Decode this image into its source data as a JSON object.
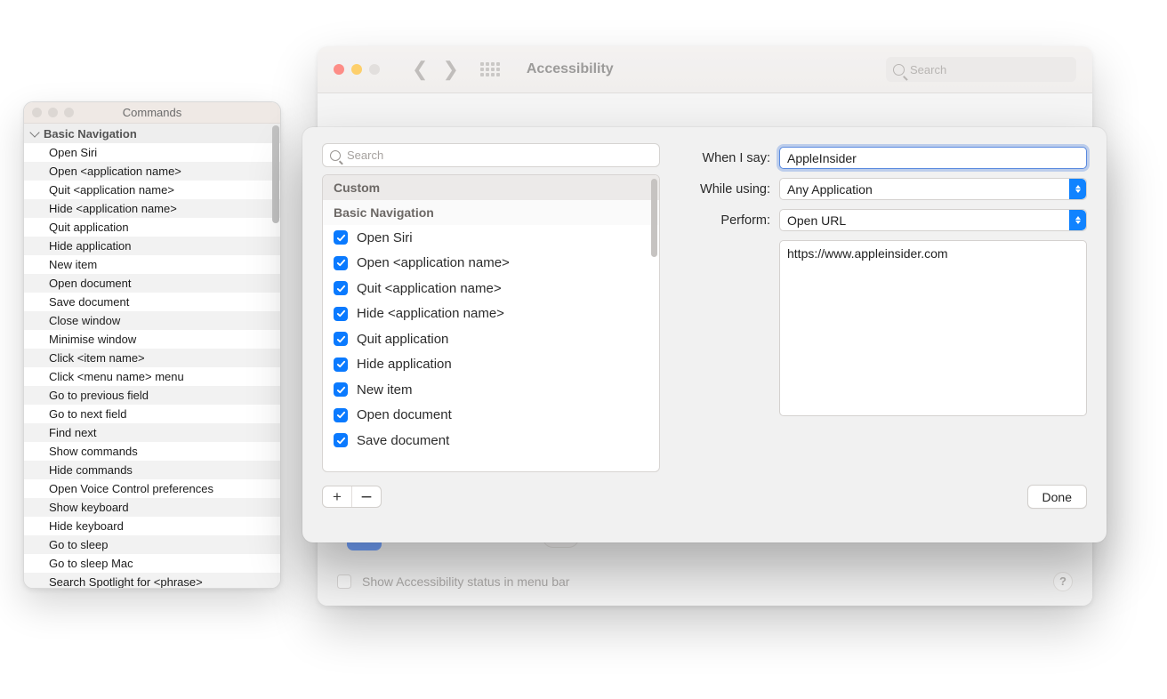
{
  "commandsWindow": {
    "title": "Commands",
    "groupHeader": "Basic Navigation",
    "items": [
      "Open Siri",
      "Open <application name>",
      "Quit <application name>",
      "Hide <application name>",
      "Quit application",
      "Hide application",
      "New item",
      "Open document",
      "Save document",
      "Close window",
      "Minimise window",
      "Click <item name>",
      "Click <menu name> menu",
      "Go to previous field",
      "Go to next field",
      "Find next",
      "Show commands",
      "Hide commands",
      "Open Voice Control preferences",
      "Show keyboard",
      "Hide keyboard",
      "Go to sleep",
      "Go to sleep Mac",
      "Search Spotlight for <phrase>"
    ]
  },
  "prefs": {
    "title": "Accessibility",
    "searchPlaceholder": "Search",
    "footerCheckboxLabel": "Show Accessibility status in menu bar"
  },
  "sheet": {
    "searchPlaceholder": "Search",
    "sections": {
      "custom": "Custom",
      "basic": "Basic Navigation"
    },
    "checkedCommands": [
      "Open Siri",
      "Open <application name>",
      "Quit <application name>",
      "Hide <application name>",
      "Quit application",
      "Hide application",
      "New item",
      "Open document",
      "Save document"
    ],
    "form": {
      "whenISayLabel": "When I say:",
      "whenISayValue": "AppleInsider",
      "whileUsingLabel": "While using:",
      "whileUsingValue": "Any Application",
      "performLabel": "Perform:",
      "performValue": "Open URL",
      "urlValue": "https://www.appleinsider.com"
    },
    "doneLabel": "Done"
  }
}
